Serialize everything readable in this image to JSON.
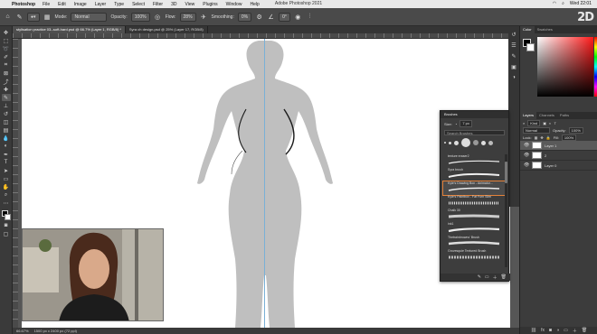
{
  "menubar": {
    "app": "Photoshop",
    "items": [
      "File",
      "Edit",
      "Image",
      "Layer",
      "Type",
      "Select",
      "Filter",
      "3D",
      "View",
      "Plugins",
      "Window",
      "Help"
    ],
    "title": "Adobe Photoshop 2021",
    "clock": "Wed 22:01"
  },
  "options": {
    "mode_label": "Mode:",
    "mode_value": "Normal",
    "opacity_label": "Opacity:",
    "opacity_value": "100%",
    "flow_label": "Flow:",
    "flow_value": "28%",
    "smoothing_label": "Smoothing:",
    "smoothing_value": "0%",
    "angle_value": "0°"
  },
  "tabs": [
    {
      "label": "stylisation practice 03--soft-hard.psd @ 66.7% (Layer 1, RGB/8) *",
      "active": true
    },
    {
      "label": "Syra ch design.psd @ 25% (Layer 17, RGB/8)",
      "active": false
    }
  ],
  "statusbar": {
    "zoom": "66.67%",
    "doc": "1500 px x 2400 px (72 ppi)"
  },
  "brushes_panel": {
    "title": "Brushes",
    "size_label": "Size:",
    "size_value": "7 px",
    "search_placeholder": "Search Brushes",
    "items": [
      {
        "name": "texture eraser2",
        "selected": false
      },
      {
        "name": "Syra brush",
        "selected": false
      },
      {
        "name": "Kyle's Drawing Box - Animator...",
        "selected": true
      },
      {
        "name": "Kyle's Paintbox - Fat Furn Slim",
        "selected": false
      },
      {
        "name": "Chalk 30",
        "selected": false
      },
      {
        "name": "ink1",
        "selected": false
      },
      {
        "name": "Thetrainbrowns' Brush",
        "selected": false
      },
      {
        "name": "Grovesquie Textured Brush",
        "selected": false
      }
    ]
  },
  "color_panel": {
    "tabs": [
      "Color",
      "Swatches"
    ]
  },
  "layers_panel": {
    "tabs": [
      "Layers",
      "Channels",
      "Paths"
    ],
    "kind_label": "Kind",
    "blend_mode": "Normal",
    "opacity_label": "Opacity:",
    "opacity_value": "100%",
    "lock_label": "Lock:",
    "fill_label": "Fill:",
    "fill_value": "100%",
    "layers": [
      {
        "name": "Layer 1",
        "active": true
      },
      {
        "name": "2",
        "active": false
      },
      {
        "name": "Layer 0",
        "active": false
      }
    ]
  },
  "watermark": "2D",
  "colors": {
    "accent_orange": "#e4823a",
    "guide_blue": "#7ab0d6",
    "figure_gray": "#bfbfbf"
  },
  "icons": [
    "apple-icon",
    "brush-tool-icon",
    "move-tool-icon",
    "eye-icon",
    "search-icon",
    "gear-icon"
  ]
}
